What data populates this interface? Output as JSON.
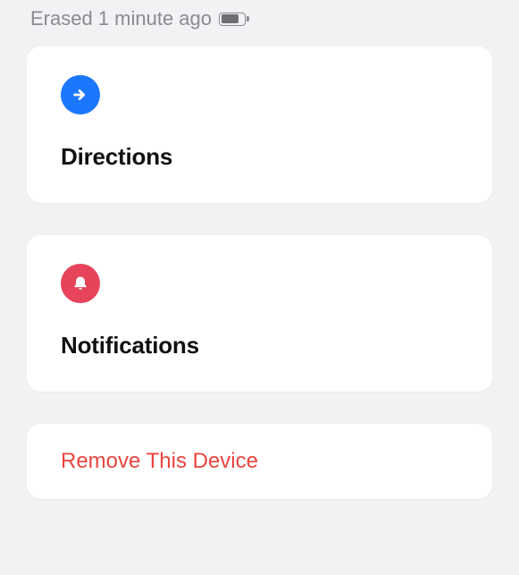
{
  "status": {
    "text": "Erased 1 minute ago"
  },
  "cards": {
    "directions": {
      "title": "Directions"
    },
    "notifications": {
      "title": "Notifications"
    }
  },
  "remove": {
    "label": "Remove This Device"
  }
}
